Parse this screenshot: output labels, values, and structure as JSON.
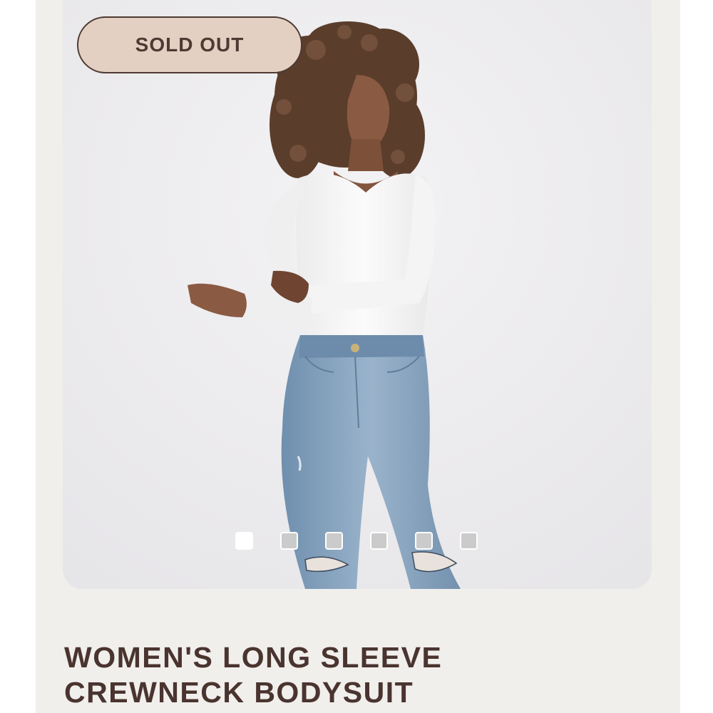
{
  "badge": {
    "label": "SOLD OUT"
  },
  "product": {
    "title": "WOMEN'S LONG SLEEVE CREWNECK BODYSUIT",
    "image_alt": "Model wearing white long sleeve crewneck bodysuit with light blue distressed jeans"
  },
  "carousel": {
    "total_slides": 6,
    "active_index": 1
  },
  "colors": {
    "page_bg": "#f1efec",
    "badge_bg": "#e4d0c2",
    "title_text": "#4a342f",
    "bodysuit": "#f7f7f7",
    "denim": "#8ba7c2"
  }
}
